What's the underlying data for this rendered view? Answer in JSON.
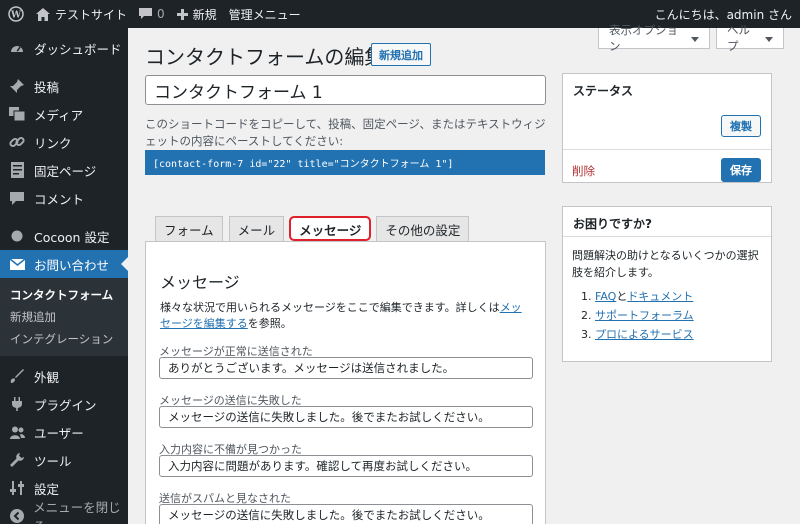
{
  "adminbar": {
    "site_name": "テストサイト",
    "comments_count": "0",
    "new_label": "新規",
    "admin_menu_label": "管理メニュー",
    "greeting": "こんにちは、admin さん"
  },
  "sidebar": {
    "dashboard": "ダッシュボード",
    "posts": "投稿",
    "media": "メディア",
    "links": "リンク",
    "pages": "固定ページ",
    "comments": "コメント",
    "cocoon": "Cocoon 設定",
    "contact": "お問い合わせ",
    "sub_contact_forms": "コンタクトフォーム",
    "sub_add_new": "新規追加",
    "sub_integration": "インテグレーション",
    "appearance": "外観",
    "plugins": "プラグイン",
    "users": "ユーザー",
    "tools": "ツール",
    "settings": "設定",
    "collapse": "メニューを閉じる"
  },
  "header": {
    "screen_options": "表示オプション",
    "help": "ヘルプ",
    "title": "コンタクトフォームの編集",
    "add_new": "新規追加"
  },
  "form": {
    "title_value": "コンタクトフォーム 1",
    "shortcode_desc": "このショートコードをコピーして、投稿、固定ページ、またはテキストウィジェットの内容にペーストしてください:",
    "shortcode": "[contact-form-7 id=\"22\" title=\"コンタクトフォーム 1\"]"
  },
  "tabs": {
    "form": "フォーム",
    "mail": "メール",
    "messages": "メッセージ",
    "other": "その他の設定"
  },
  "panel": {
    "title": "メッセージ",
    "desc_prefix": "様々な状況で用いられるメッセージをここで編集できます。詳しくは",
    "desc_link": "メッセージを編集する",
    "desc_suffix": "を参照。",
    "fields": [
      {
        "label": "メッセージが正常に送信された",
        "value": "ありがとうございます。メッセージは送信されました。"
      },
      {
        "label": "メッセージの送信に失敗した",
        "value": "メッセージの送信に失敗しました。後でまたお試しください。"
      },
      {
        "label": "入力内容に不備が見つかった",
        "value": "入力内容に問題があります。確認して再度お試しください。"
      },
      {
        "label": "送信がスパムと見なされた",
        "value": "メッセージの送信に失敗しました。後でまたお試しください。"
      }
    ]
  },
  "status_box": {
    "title": "ステータス",
    "duplicate": "複製",
    "delete": "削除",
    "save": "保存"
  },
  "help_box": {
    "title": "お困りですか?",
    "desc": "問題解決の助けとなるいくつかの選択肢を紹介します。",
    "item1_num": "1.",
    "item1_faq": "FAQ",
    "item1_and": "と",
    "item1_docs": "ドキュメント",
    "item2_num": "2.",
    "item2_forum": "サポートフォーラム",
    "item3_num": "3.",
    "item3_pro": "プロによるサービス"
  }
}
